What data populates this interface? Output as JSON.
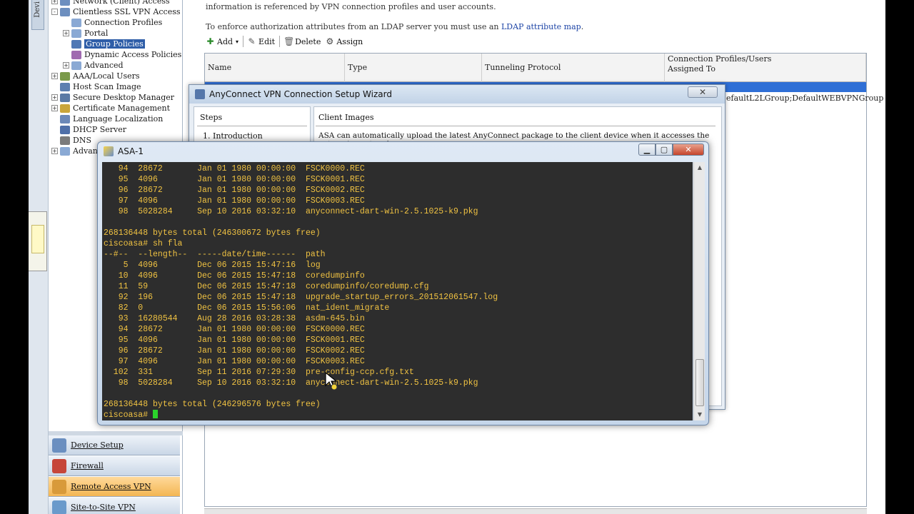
{
  "asdm": {
    "left_tab": "Devi",
    "tree": [
      {
        "label": "Network (Client) Access",
        "indent": 0,
        "expander": "+"
      },
      {
        "label": "Clientless SSL VPN Access",
        "indent": 0,
        "expander": "-"
      },
      {
        "label": "Connection Profiles",
        "indent": 1,
        "expander": ""
      },
      {
        "label": "Portal",
        "indent": 1,
        "expander": "+"
      },
      {
        "label": "Group Policies",
        "indent": 1,
        "expander": "",
        "selected": true
      },
      {
        "label": "Dynamic Access Policies",
        "indent": 1,
        "expander": ""
      },
      {
        "label": "Advanced",
        "indent": 1,
        "expander": "+"
      },
      {
        "label": "AAA/Local Users",
        "indent": 0,
        "expander": "+"
      },
      {
        "label": "Host Scan Image",
        "indent": 0,
        "expander": ""
      },
      {
        "label": "Secure Desktop Manager",
        "indent": 0,
        "expander": "+"
      },
      {
        "label": "Certificate Management",
        "indent": 0,
        "expander": "+"
      },
      {
        "label": "Language Localization",
        "indent": 0,
        "expander": ""
      },
      {
        "label": "DHCP Server",
        "indent": 0,
        "expander": ""
      },
      {
        "label": "DNS",
        "indent": 0,
        "expander": ""
      },
      {
        "label": "Advan",
        "indent": 0,
        "expander": "+"
      }
    ],
    "nav_buttons": [
      {
        "label": "Device Setup",
        "active": false
      },
      {
        "label": "Firewall",
        "active": false
      },
      {
        "label": "Remote Access VPN",
        "active": true
      },
      {
        "label": "Site-to-Site VPN",
        "active": false
      }
    ],
    "info_line1": "information is referenced by VPN connection profiles and user accounts.",
    "info_line2_prefix": "To enforce authorization attributes from an LDAP server you must use an ",
    "info_line2_link": "LDAP attribute map",
    "info_line2_suffix": ".",
    "toolbar": {
      "add": "Add",
      "edit": "Edit",
      "delete": "Delete",
      "assign": "Assign"
    },
    "table": {
      "headers": [
        "Name",
        "Type",
        "Tunneling Protocol",
        "Connection Profiles/Users\nAssigned To"
      ],
      "row2_text": "efaultL2LGroup;DefaultWEBVPNGroup"
    }
  },
  "wizard": {
    "title": "AnyConnect VPN Connection Setup Wizard",
    "steps_header": "Steps",
    "step1": "1.  Introduction",
    "panel_header": "Client Images",
    "panel_text": "ASA can automatically upload the latest AnyConnect package to the client device when it accesses the enterprise network."
  },
  "terminal": {
    "title": "ASA-1",
    "lines": [
      "   94  28672       Jan 01 1980 00:00:00  FSCK0000.REC",
      "   95  4096        Jan 01 1980 00:00:00  FSCK0001.REC",
      "   96  28672       Jan 01 1980 00:00:00  FSCK0002.REC",
      "   97  4096        Jan 01 1980 00:00:00  FSCK0003.REC",
      "   98  5028284     Sep 10 2016 03:32:10  anyconnect-dart-win-2.5.1025-k9.pkg",
      "",
      "268136448 bytes total (246300672 bytes free)",
      "ciscoasa# sh fla",
      "--#--  --length--  -----date/time------  path",
      "    5  4096        Dec 06 2015 15:47:16  log",
      "   10  4096        Dec 06 2015 15:47:18  coredumpinfo",
      "   11  59          Dec 06 2015 15:47:18  coredumpinfo/coredump.cfg",
      "   92  196         Dec 06 2015 15:47:18  upgrade_startup_errors_201512061547.log",
      "   82  0           Dec 06 2015 15:56:06  nat_ident_migrate",
      "   93  16280544    Aug 28 2016 03:28:38  asdm-645.bin",
      "   94  28672       Jan 01 1980 00:00:00  FSCK0000.REC",
      "   95  4096        Jan 01 1980 00:00:00  FSCK0001.REC",
      "   96  28672       Jan 01 1980 00:00:00  FSCK0002.REC",
      "   97  4096        Jan 01 1980 00:00:00  FSCK0003.REC",
      "  102  331         Sep 11 2016 07:29:30  pre-config-ccp.cfg.txt",
      "   98  5028284     Sep 10 2016 03:32:10  anyconnect-dart-win-2.5.1025-k9.pkg",
      "",
      "268136448 bytes total (246296576 bytes free)"
    ],
    "prompt": "ciscoasa# "
  },
  "colors": {
    "terminal_text": "#f0c242",
    "terminal_bg": "#2d2d2d",
    "cursor": "#2bd42b",
    "selection": "#2f5ea8",
    "nav_active": "#f3b653"
  }
}
